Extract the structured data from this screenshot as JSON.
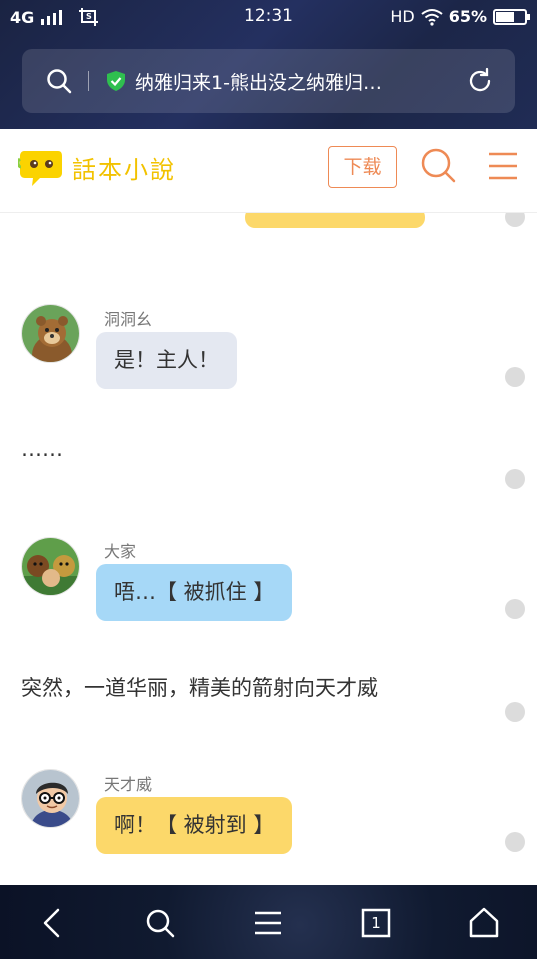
{
  "status_bar": {
    "network": "4G",
    "time": "12:31",
    "hd": "HD",
    "battery_percent": "65%",
    "battery_level": 0.65
  },
  "browser": {
    "url_title": "纳雅归来1-熊出没之纳雅归…",
    "icons": [
      "search-icon",
      "shield-check-icon",
      "refresh-icon"
    ]
  },
  "site_header": {
    "logo_text": "話本小說",
    "download_label": "下载",
    "icons": [
      "search-icon",
      "menu-icon"
    ]
  },
  "chat": [
    {
      "type": "message",
      "speaker": "洞洞幺",
      "text": "是！主人！",
      "bubble_color": "#e4e8f1",
      "avatar": "bear-avatar"
    },
    {
      "type": "narration",
      "text": "……"
    },
    {
      "type": "message",
      "speaker": "大家",
      "text": "唔…【 被抓住 】",
      "bubble_color": "#a6d8f7",
      "avatar": "group-avatar"
    },
    {
      "type": "narration",
      "text": "突然，一道华丽，精美的箭射向天才威"
    },
    {
      "type": "message",
      "speaker": "天才威",
      "text": "啊！【 被射到 】",
      "bubble_color": "#fcd86a",
      "avatar": "boy-glasses-avatar"
    }
  ],
  "colors": {
    "accent": "#ee8a55",
    "logo_yellow": "#f2c200"
  },
  "bottom_nav": {
    "tab_count": "1",
    "icons": [
      "back-icon",
      "search-icon",
      "menu-icon",
      "tabs-icon",
      "home-icon"
    ]
  }
}
